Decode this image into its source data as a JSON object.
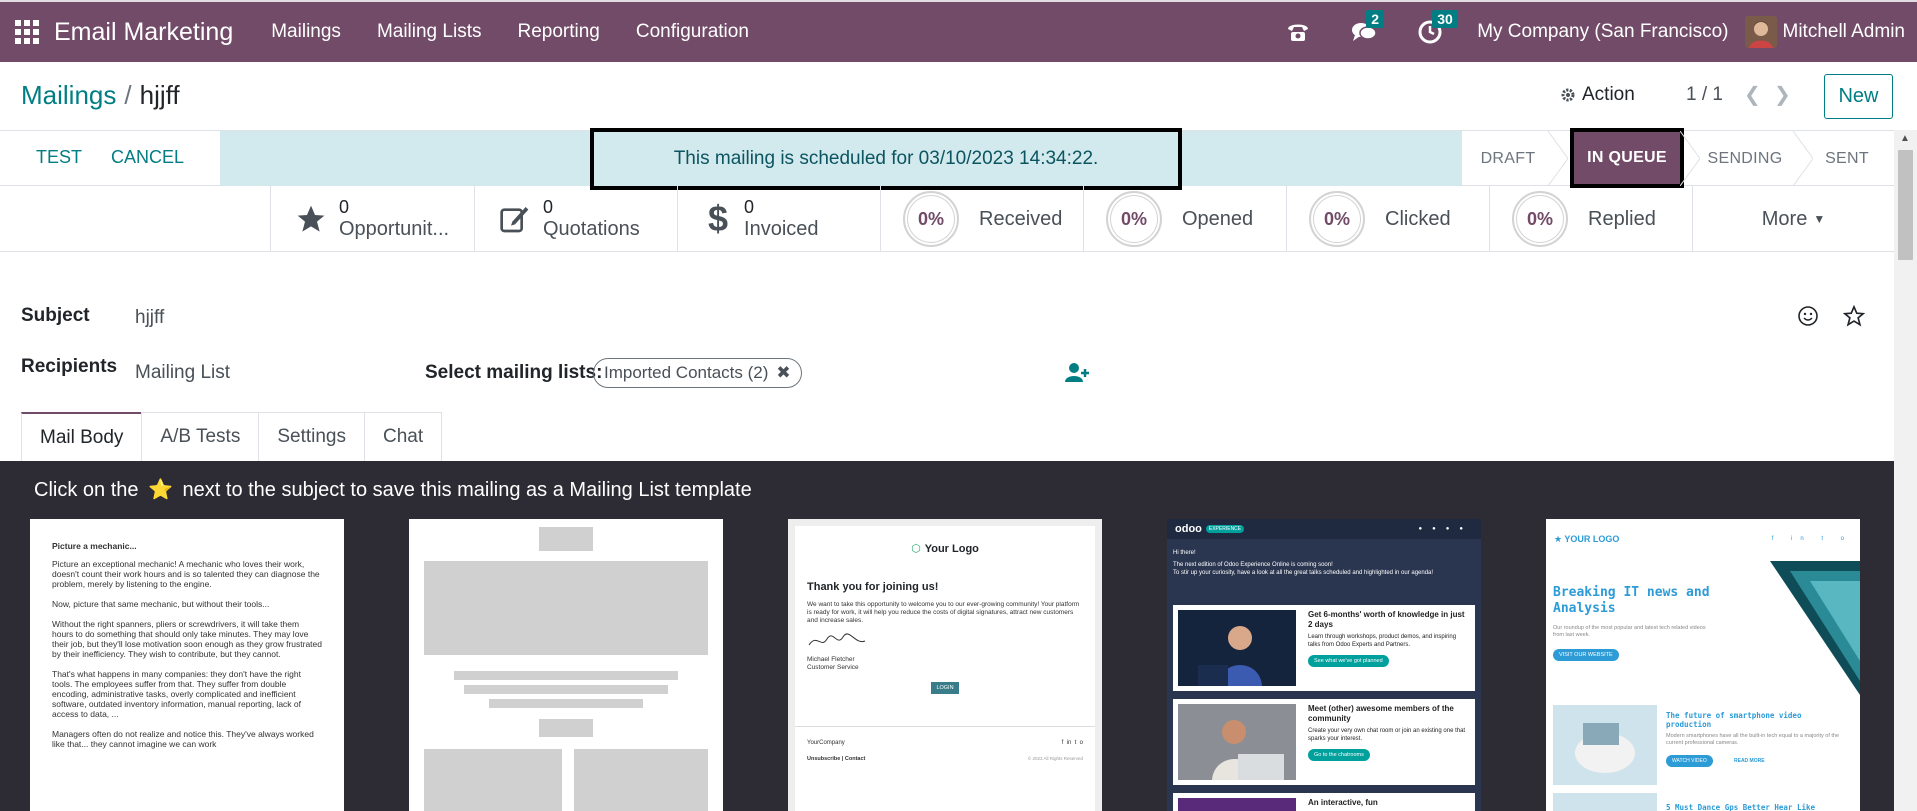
{
  "topbar": {
    "app_name": "Email Marketing",
    "menu": [
      "Mailings",
      "Mailing Lists",
      "Reporting",
      "Configuration"
    ],
    "chat_count": "2",
    "activity_count": "30",
    "company": "My Company (San Francisco)",
    "user": "Mitchell Admin"
  },
  "breadcrumb": {
    "parent": "Mailings",
    "separator": "/",
    "current": "hjjff"
  },
  "controls": {
    "action": "Action",
    "pager": "1 / 1",
    "new": "New"
  },
  "statusbar": {
    "test": "TEST",
    "cancel": "CANCEL",
    "alert": "This mailing is scheduled for 03/10/2023 14:34:22.",
    "stages": [
      "DRAFT",
      "IN QUEUE",
      "SENDING",
      "SENT"
    ],
    "active_stage": "IN QUEUE"
  },
  "stats": [
    {
      "value": "0",
      "label": "Opportunit..."
    },
    {
      "value": "0",
      "label": "Quotations"
    },
    {
      "value": "0",
      "label": "Invoiced"
    }
  ],
  "rates": [
    {
      "value": "0%",
      "label": "Received"
    },
    {
      "value": "0%",
      "label": "Opened"
    },
    {
      "value": "0%",
      "label": "Clicked"
    },
    {
      "value": "0%",
      "label": "Replied"
    }
  ],
  "more": "More",
  "form": {
    "subject_label": "Subject",
    "subject_value": "hjjff",
    "recipients_label": "Recipients",
    "recipients_value": "Mailing List",
    "lists_label": "Select mailing lists:",
    "list_tag": "Imported Contacts (2)"
  },
  "tabs": [
    "Mail Body",
    "A/B Tests",
    "Settings",
    "Chat"
  ],
  "body": {
    "hint_pre": "Click on the",
    "hint_post": "next to the subject to save this mailing as a Mailing List template"
  },
  "templates": {
    "t1": {
      "lines": [
        "Picture a mechanic...",
        "Picture an exceptional mechanic! A mechanic who loves their work, doesn't count their work hours and is so talented they can diagnose the problem, merely by listening to the engine.",
        "Now, picture that same mechanic, but without their tools...",
        "Without the right spanners, pliers or screwdrivers, it will take them hours to do something that should only take minutes. They may love their job, but they'll lose motivation soon enough as they grow frustrated by their inefficiency. They wish to contribute, but they cannot.",
        "That's what happens in many companies: they don't have the right tools. The employees suffer from that. They suffer from double encoding, administrative tasks, overly complicated and inefficient software, outdated inventory information, manual reporting, lack of access to data, ...",
        "Managers often do not realize and notice this. They've always worked like that... they cannot imagine we can work"
      ]
    },
    "t3": {
      "logo": "Your Logo",
      "title": "Thank you for joining us!",
      "text": "We want to take this opportunity to welcome you to our ever-growing community! Your platform is ready for work, it will help you reduce the costs of digital signatures, attract new customers and increase sales.",
      "signer": "Michael Fletcher",
      "role": "Customer Service",
      "button": "LOGIN",
      "company": "YourCompany",
      "links": "Unsubscribe | Contact",
      "rights": "© 2023 All Rights Reserved"
    },
    "t4": {
      "brand": "odoo",
      "tag": "EXPERIENCE",
      "greet": "Hi there!",
      "intro": "The next edition of Odoo Experience Online is coming soon!",
      "intro2": "To stir up your curiosity, have a look at all the great talks scheduled and highlighted in our agenda!",
      "h1": "Get 6-months' worth of knowledge in just 2 days",
      "p1": "Learn through workshops, product demos, and inspiring talks from Odoo Experts and Partners.",
      "b1": "See what we've got planned",
      "h2": "Meet (other) awesome members of the community",
      "p2": "Create your very own chat room or join an existing one that sparks your interest.",
      "b2": "Go to the chatrooms",
      "h3": "An interactive, fun"
    },
    "t5": {
      "logo": "YOUR LOGO",
      "title": "Breaking IT news and Analysis",
      "sub": "Our roundup of the most popular and latest tech related videos from last week.",
      "button": "VISIT OUR WEBSITE",
      "h1": "The future of smartphone video production",
      "p1": "Modern smartphones have all the built-in tech equal to a majority of the current professional cameras.",
      "b1": "WATCH VIDEO",
      "b2": "READ MORE",
      "h2": "5 Must Dance Gps Better Hear Like"
    }
  },
  "colors": {
    "primary": "#714b67",
    "teal": "#017e84",
    "dark": "#2d2c35"
  }
}
